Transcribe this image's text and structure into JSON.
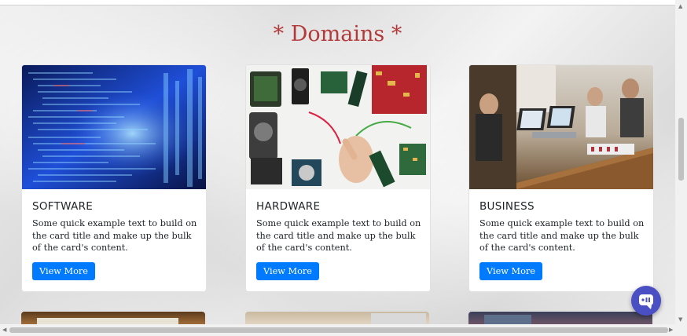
{
  "section_title": "* Domains *",
  "cards": [
    {
      "title": "SOFTWARE",
      "text": "Some quick example text to build on the card title and make up the bulk of the card's content.",
      "button": "View More",
      "image": "code-screen-image"
    },
    {
      "title": "HARDWARE",
      "text": "Some quick example text to build on the card title and make up the bulk of the card's content.",
      "button": "View More",
      "image": "hardware-components-image"
    },
    {
      "title": "BUSINESS",
      "text": "Some quick example text to build on the card title and make up the bulk of the card's content.",
      "button": "View More",
      "image": "business-meeting-image"
    }
  ],
  "colors": {
    "title": "#b33a3a",
    "button": "#007bff",
    "chat": "#4b4fc4"
  },
  "icons": {
    "chat": "chat-bubble-icon"
  }
}
